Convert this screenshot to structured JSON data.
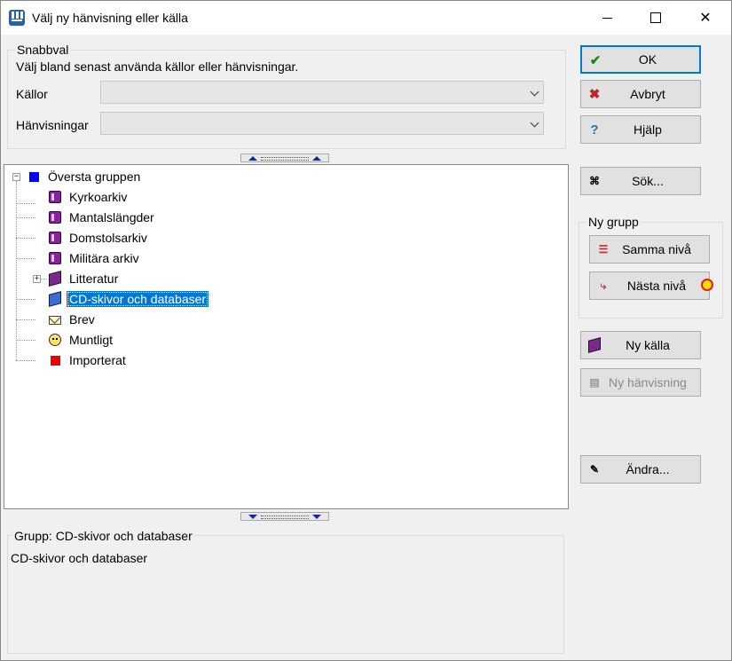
{
  "window": {
    "title": "Välj ny hänvisning eller källa"
  },
  "snabbval": {
    "legend": "Snabbval",
    "description": "Välj bland senast använda källor eller hänvisningar.",
    "kallor_label": "Källor",
    "kallor_value": "",
    "hanvisningar_label": "Hänvisningar",
    "hanvisningar_value": ""
  },
  "tree": {
    "root": "Översta gruppen",
    "items": [
      {
        "label": "Kyrkoarkiv",
        "icon": "books-icon"
      },
      {
        "label": "Mantalslängder",
        "icon": "books-icon"
      },
      {
        "label": "Domstolsarkiv",
        "icon": "books-icon"
      },
      {
        "label": "Militära arkiv",
        "icon": "books-icon"
      },
      {
        "label": "Litteratur",
        "icon": "book-icon"
      },
      {
        "label": "CD-skivor och databaser",
        "icon": "cd-icon",
        "selected": true
      },
      {
        "label": "Brev",
        "icon": "envelope-icon"
      },
      {
        "label": "Muntligt",
        "icon": "face-icon"
      },
      {
        "label": "Importerat",
        "icon": "red-square-icon"
      }
    ]
  },
  "details": {
    "legend": "Grupp: CD-skivor och databaser",
    "text": "CD-skivor och databaser"
  },
  "buttons": {
    "ok": "OK",
    "avbryt": "Avbryt",
    "hjalp": "Hjälp",
    "sok": "Sök...",
    "ny_grupp_legend": "Ny grupp",
    "samma_niva": "Samma nivå",
    "nasta_niva": "Nästa nivå",
    "ny_kalla": "Ny källa",
    "ny_hanvisning": "Ny hänvisning",
    "andra": "Ändra..."
  },
  "colors": {
    "accent": "#0078d7",
    "selection": "#0078d7",
    "root_square": "#0000ff",
    "imported_square": "#ee0000"
  }
}
